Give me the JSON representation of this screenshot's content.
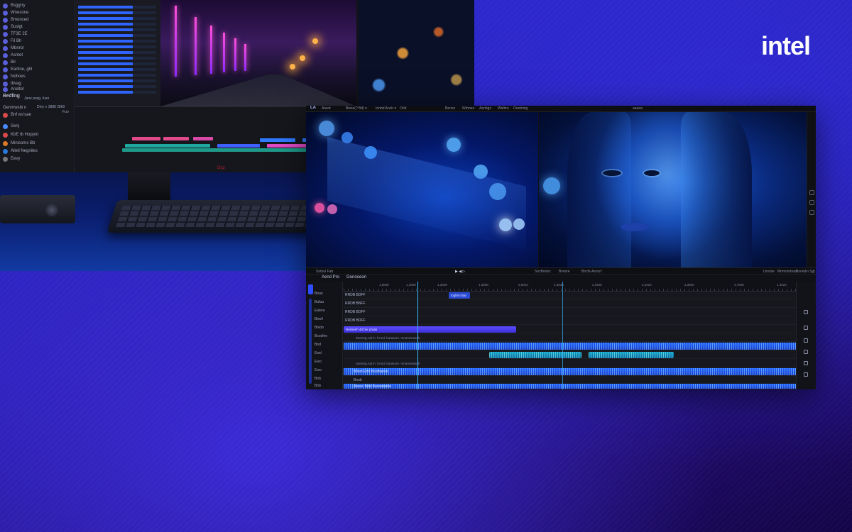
{
  "brand": {
    "logo_text": "intel",
    "logo_color": "#ffffff",
    "background_accent": "#2a2bd8"
  },
  "back_monitor": {
    "sidebar_items": [
      "Bsggrry",
      "Wnesone",
      "Bmonced",
      "Suslgt",
      "TF3E 2E",
      "Fil Bh",
      "Mbnrol",
      "Asntet",
      "Bil",
      "Eartine, ghl",
      "Nohoes",
      "Ibvag",
      "Tasmone",
      "Aneltet"
    ],
    "section_title": "Bedfing",
    "section_sub": "Jane psqg, fuso",
    "panel_items": [
      "Genmwsbi n",
      "Bnf ws'sae",
      "Senj",
      "KbE Ib Hoppnt",
      "Minisoms Bb",
      "Allell Negnites",
      "Eevy"
    ],
    "small_labels": [
      "Diny ≡ 3888 2860",
      "Fuo"
    ],
    "monitor_brand": "Dcp"
  },
  "editor": {
    "logo": "LA",
    "menu": [
      "Anwd",
      "Bwse(? Bd) ▾",
      "Innbd Anclr ▾",
      "Orld",
      "Benes",
      "Wmnee",
      "Aenbgs",
      "Weibre",
      "Oentning"
    ],
    "top_center_label": "aaaaa",
    "transport": {
      "left": "Sotoul  Fab",
      "center": [
        "Sncfisnioc",
        "Bvnsre",
        "Bncfs-Asncrt"
      ],
      "right": [
        "Ltncise",
        "Mnmomtoas",
        "Bone&n Sgt"
      ]
    },
    "panel_title": "Aend Pro",
    "timeline_title": "Gonooeon",
    "left_labels": [
      "Bnao",
      "Bufua",
      "Ealera",
      "Bisvil",
      "Bniob",
      "Bcosfne",
      "Bnd",
      "Ewd",
      "Ewo",
      "Ewo",
      "Bnb",
      "Bnb",
      "Bnb"
    ],
    "track_headers": [
      "RRDB BDFF",
      "RRDB BNFF",
      "RRDB BDFF",
      "RRDB BDFF",
      "",
      "",
      "",
      "",
      "",
      "",
      "",
      ""
    ],
    "ruler_labels": [
      "1,8808",
      "1,3808",
      "1,3808",
      "1,3808",
      "2,8003",
      "2,3838",
      "2,0928",
      "3,1020",
      "3,3800",
      "4,7808",
      "1,3020"
    ],
    "clips": {
      "purple_main": "Nessenh 40 ber praas",
      "row_text_1": "Saneng Aal ln. hAnd. barasore. mnannewanh",
      "row_text_2": "Saneng Aal ln. hAnd. barasore. mnannewanh",
      "audio_1": "Bltnot Ehh Boofbaese",
      "audio_2": "Bnob",
      "audio_3": "Bnuse Bdsl Baoostesbe",
      "marker": "Ingfmn Bar"
    }
  }
}
